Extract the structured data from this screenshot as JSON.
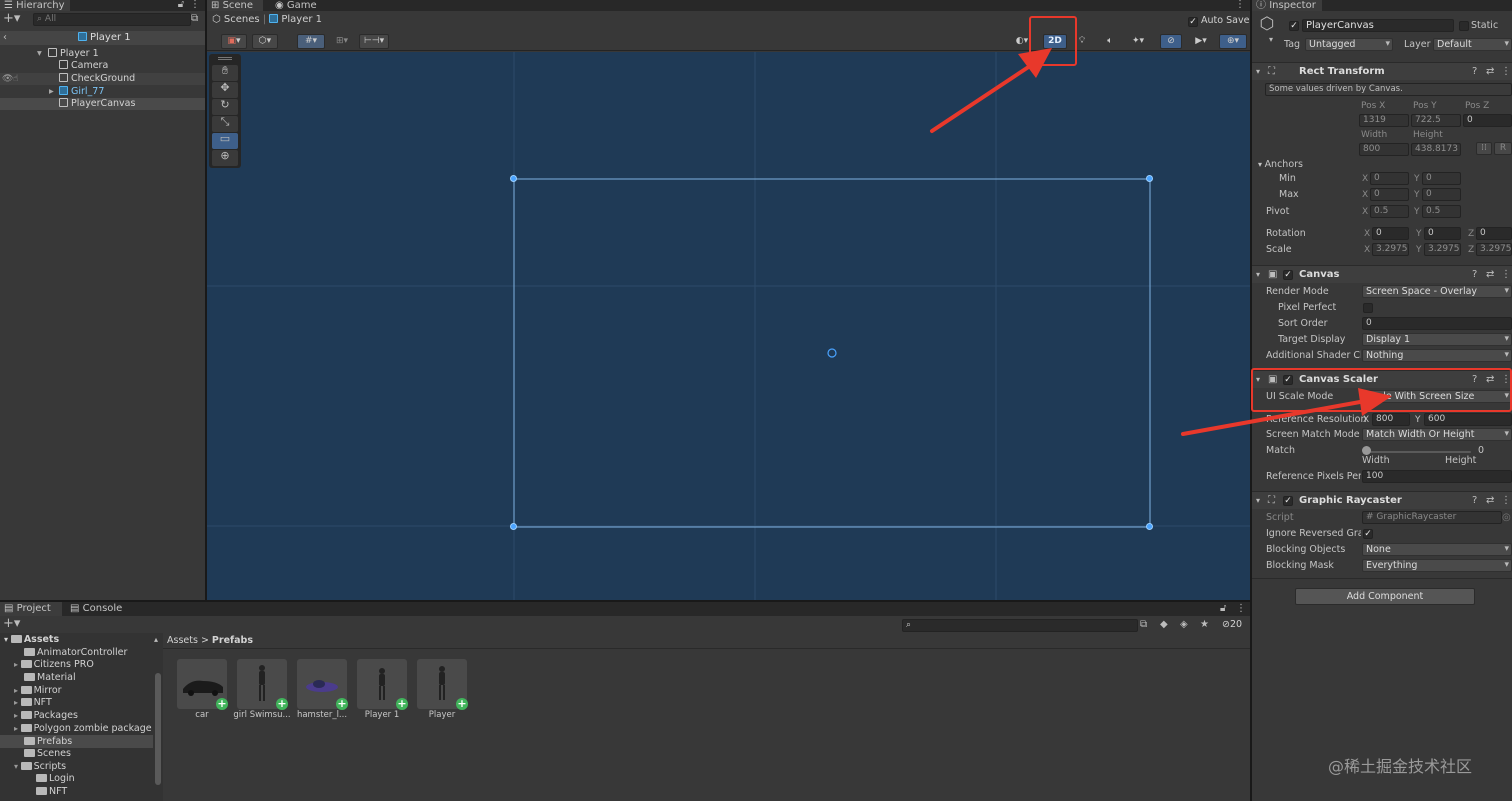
{
  "hierarchy": {
    "tab": "Hierarchy",
    "search_placeholder": "All",
    "scene_header": "Player 1",
    "items": [
      {
        "label": "Player 1",
        "prefab": false
      },
      {
        "label": "Camera"
      },
      {
        "label": "CheckGround"
      },
      {
        "label": "Girl_77"
      },
      {
        "label": "PlayerCanvas"
      }
    ]
  },
  "scene": {
    "tab_scene": "Scene",
    "tab_game": "Game",
    "breadcrumb_root": "Scenes",
    "breadcrumb_current": "Player 1",
    "auto_save": "Auto Save",
    "btn_2d": "2D"
  },
  "inspector": {
    "tab": "Inspector",
    "object_name": "PlayerCanvas",
    "static_label": "Static",
    "tag_label": "Tag",
    "tag_value": "Untagged",
    "layer_label": "Layer",
    "layer_value": "Default",
    "rect_transform": {
      "title": "Rect Transform",
      "note": "Some values driven by Canvas.",
      "pos_x_label": "Pos X",
      "pos_y_label": "Pos Y",
      "pos_z_label": "Pos Z",
      "pos_x": "1319",
      "pos_y": "722.5",
      "pos_z": "0",
      "width_label": "Width",
      "height_label": "Height",
      "width": "800",
      "height": "438.8173",
      "r_btn": "R",
      "anchors_label": "Anchors",
      "min_label": "Min",
      "max_label": "Max",
      "min_x": "0",
      "min_y": "0",
      "max_x": "0",
      "max_y": "0",
      "pivot_label": "Pivot",
      "pivot_x": "0.5",
      "pivot_y": "0.5",
      "rotation_label": "Rotation",
      "rot_x": "0",
      "rot_y": "0",
      "rot_z": "0",
      "scale_label": "Scale",
      "scale_x": "3.2975",
      "scale_y": "3.2975",
      "scale_z": "3.2975"
    },
    "canvas": {
      "title": "Canvas",
      "render_mode_label": "Render Mode",
      "render_mode": "Screen Space - Overlay",
      "pixel_perfect_label": "Pixel Perfect",
      "sort_order_label": "Sort Order",
      "sort_order": "0",
      "target_display_label": "Target Display",
      "target_display": "Display 1",
      "shader_label": "Additional Shader Ch",
      "shader": "Nothing"
    },
    "canvas_scaler": {
      "title": "Canvas Scaler",
      "ui_scale_mode_label": "UI Scale Mode",
      "ui_scale_mode": "Scale With Screen Size",
      "ref_res_label": "Reference Resolution",
      "ref_x": "800",
      "ref_y": "600",
      "match_mode_label": "Screen Match Mode",
      "match_mode": "Match Width Or Height",
      "match_label": "Match",
      "match_value": "0",
      "match_left": "Width",
      "match_right": "Height",
      "ref_ppu_label": "Reference Pixels Per",
      "ref_ppu": "100"
    },
    "graphic_raycaster": {
      "title": "Graphic Raycaster",
      "script_label": "Script",
      "script": "GraphicRaycaster",
      "ignore_label": "Ignore Reversed Grap",
      "blocking_objects_label": "Blocking Objects",
      "blocking_objects": "None",
      "blocking_mask_label": "Blocking Mask",
      "blocking_mask": "Everything"
    },
    "add_component": "Add Component"
  },
  "project": {
    "tab_project": "Project",
    "tab_console": "Console",
    "tree_root": "Assets",
    "tree": [
      "AnimatorController",
      "Citizens PRO",
      "Material",
      "Mirror",
      "NFT",
      "Packages",
      "Polygon zombie package",
      "Prefabs",
      "Scenes",
      "Scripts",
      "Login",
      "NFT"
    ],
    "path_root": "Assets",
    "path_current": "Prefabs",
    "hidden_count": "20",
    "assets": [
      "car",
      "girl Swimsu...",
      "hamster_l...",
      "Player 1",
      "Player"
    ]
  },
  "watermark": "@稀土掘金技术社区",
  "colors": {
    "scene_bg": "#1f3a56",
    "highlight": "#e8382b",
    "selection": "#4a4a4a"
  }
}
